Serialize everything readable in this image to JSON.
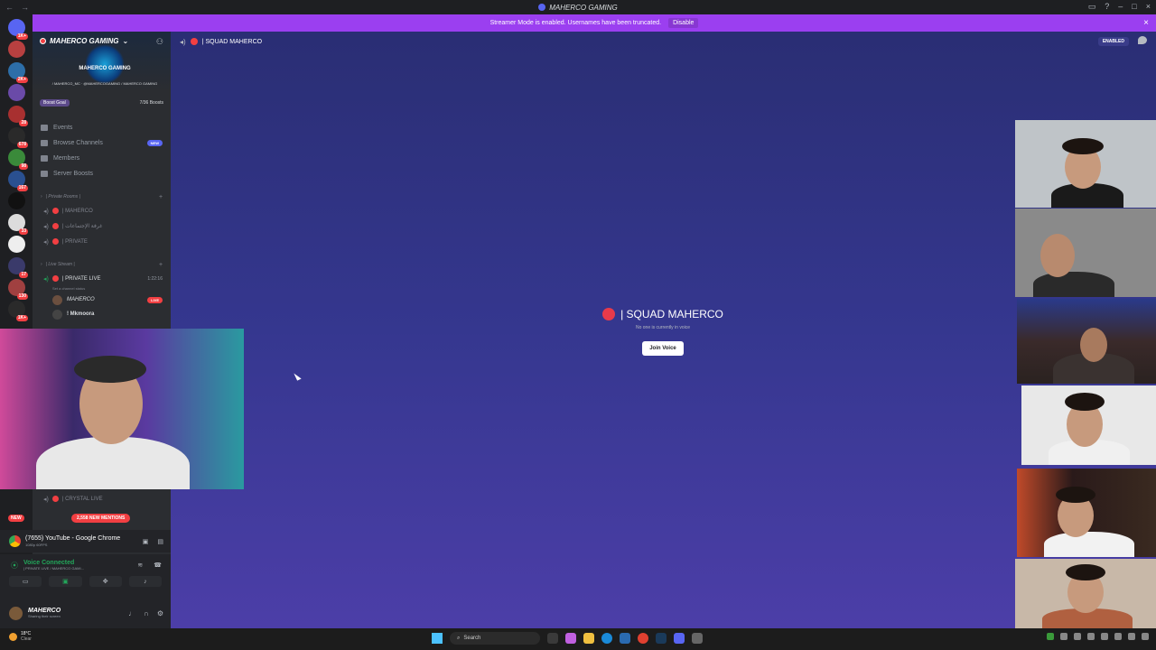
{
  "window": {
    "title": "MAHERCO GAMING"
  },
  "banner": {
    "text": "Streamer Mode is enabled. Usernames have been truncated.",
    "disable_label": "Disable"
  },
  "server": {
    "name": "MAHERCO GAMING",
    "emblem_text": "MAHERCO GAMING",
    "social": "/ MAHERCO_MC · @MAHERCOGAMING / MAHERCO GAMING",
    "boost_goal_label": "Boost Goal",
    "boost_count": "7/36 Boosts"
  },
  "menu": [
    {
      "label": "Events"
    },
    {
      "label": "Browse Channels",
      "badge": "NEW"
    },
    {
      "label": "Members"
    },
    {
      "label": "Server Boosts"
    }
  ],
  "categories": {
    "private": "| Private Rooms |",
    "live": "| Live Stream |"
  },
  "private_channels": [
    {
      "name": "| MAHERCO"
    },
    {
      "name": "| غرفة الإجتماعات"
    },
    {
      "name": "| PRIVATE"
    }
  ],
  "live_channel": {
    "name": "| PRIVATE LIVE",
    "duration": "1:22:16",
    "status": "Set a channel status"
  },
  "members": [
    {
      "name": "MAHERCO",
      "tag": "LIVE"
    },
    {
      "name": "! Mkmoora"
    }
  ],
  "lower_channels": [
    {
      "name": "| CRYSTAL LIVE"
    }
  ],
  "pills": {
    "new": "NEW",
    "mentions": "2,558 NEW MENTIONS"
  },
  "activity": {
    "title": "(7655) YouTube - Google Chrome",
    "sub": "1080p 60FPS"
  },
  "voice": {
    "label": "Voice Connected",
    "channel": "| PRIVATE LIVE / MAHERCO GAMI..."
  },
  "user": {
    "name": "MAHERCO",
    "status": "Sharing their screen"
  },
  "main": {
    "header_channel": "| SQUAD MAHERCO",
    "enabled_badge": "ENABLED",
    "title": "| SQUAD MAHERCO",
    "subtitle": "No one is currently in voice",
    "join_label": "Join Voice"
  },
  "taskbar": {
    "weather_temp": "18°C",
    "weather_cond": "Clear",
    "search_placeholder": "Search"
  }
}
